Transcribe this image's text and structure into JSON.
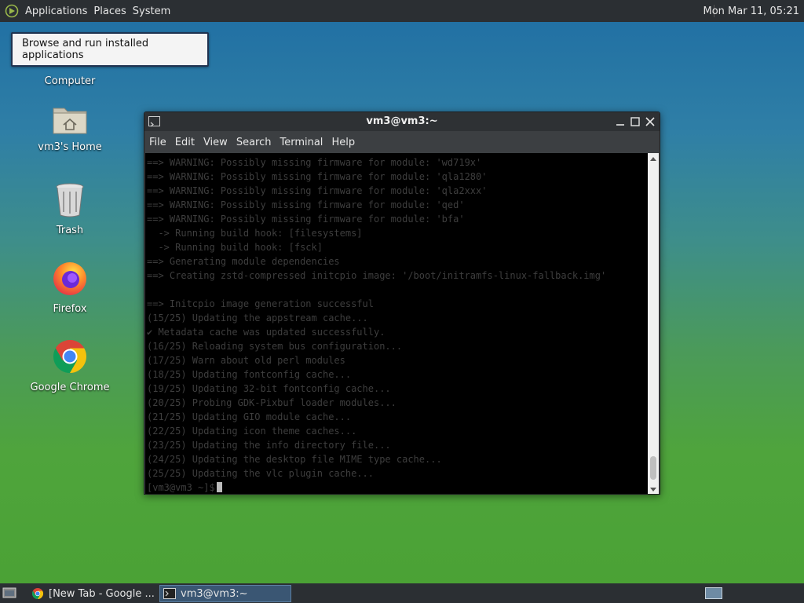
{
  "top_panel": {
    "menus": [
      "Applications",
      "Places",
      "System"
    ],
    "clock": "Mon Mar 11, 05:21"
  },
  "tooltip": {
    "text": "Browse and run installed applications"
  },
  "desktop_icons": [
    {
      "label": "Computer",
      "icon": "computer-icon"
    },
    {
      "label": "vm3's Home",
      "icon": "home-folder-icon"
    },
    {
      "label": "Trash",
      "icon": "trash-icon"
    },
    {
      "label": "Firefox",
      "icon": "firefox-icon"
    },
    {
      "label": "Google Chrome",
      "icon": "chrome-icon"
    }
  ],
  "terminal": {
    "title": "vm3@vm3:~",
    "menu": [
      "File",
      "Edit",
      "View",
      "Search",
      "Terminal",
      "Help"
    ],
    "lines": [
      "==> WARNING: Possibly missing firmware for module: 'wd719x'",
      "==> WARNING: Possibly missing firmware for module: 'qla1280'",
      "==> WARNING: Possibly missing firmware for module: 'qla2xxx'",
      "==> WARNING: Possibly missing firmware for module: 'qed'",
      "==> WARNING: Possibly missing firmware for module: 'bfa'",
      "  -> Running build hook: [filesystems]",
      "  -> Running build hook: [fsck]",
      "==> Generating module dependencies",
      "==> Creating zstd-compressed initcpio image: '/boot/initramfs-linux-fallback.img'",
      "",
      "==> Initcpio image generation successful",
      "(15/25) Updating the appstream cache...",
      "✔ Metadata cache was updated successfully.",
      "(16/25) Reloading system bus configuration...",
      "(17/25) Warn about old perl modules",
      "(18/25) Updating fontconfig cache...",
      "(19/25) Updating 32-bit fontconfig cache...",
      "(20/25) Probing GDK-Pixbuf loader modules...",
      "(21/25) Updating GIO module cache...",
      "(22/25) Updating icon theme caches...",
      "(23/25) Updating the info directory file...",
      "(24/25) Updating the desktop file MIME type cache...",
      "(25/25) Updating the vlc plugin cache..."
    ],
    "prompt": "[vm3@vm3 ~]$"
  },
  "taskbar": {
    "tasks": [
      {
        "label": "[New Tab - Google ...",
        "icon": "chrome-icon"
      },
      {
        "label": "vm3@vm3:~",
        "icon": "terminal-icon"
      }
    ]
  },
  "colors": {
    "panel": "#2b2f33",
    "terminal_bg": "#000000",
    "active_task": "#3a5673"
  }
}
